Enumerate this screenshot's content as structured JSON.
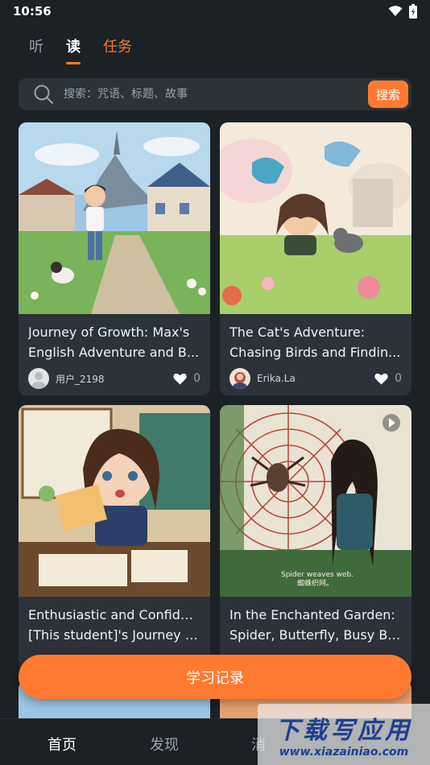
{
  "status": {
    "time": "10:56"
  },
  "tabs": [
    {
      "label": "听"
    },
    {
      "label": "读"
    },
    {
      "label": "任务"
    }
  ],
  "search": {
    "placeholder": "搜索：咒语、标题、故事",
    "button": "搜索"
  },
  "stories": [
    {
      "title_line1": "Journey of Growth: Max's",
      "title_line2": "English Adventure and B...",
      "author": "用户_2198",
      "likes": "0"
    },
    {
      "title_line1": "The Cat's Adventure:",
      "title_line2": "Chasing Birds and Findin...",
      "author": "Erika.La",
      "likes": "0"
    },
    {
      "title_line1": "Enthusiastic and Confident:",
      "title_line2": "[This student]'s Journey t...",
      "author": "",
      "likes": ""
    },
    {
      "title_line1": "In the Enchanted Garden:",
      "title_line2": "Spider, Butterfly, Busy Be...",
      "author": "",
      "likes": "",
      "image_caption_1": "Spider weaves web.",
      "image_caption_2": "蜘蛛织网。"
    }
  ],
  "cta": {
    "label": "学习记录"
  },
  "bottom_nav": [
    {
      "label": "首页"
    },
    {
      "label": "发现"
    },
    {
      "label": "消"
    }
  ],
  "watermark": {
    "title": "下载写应用",
    "url": "www.xiazainiao.com"
  },
  "colors": {
    "accent": "#ff7a30",
    "background": "#1c2126",
    "card": "#2b323a"
  }
}
